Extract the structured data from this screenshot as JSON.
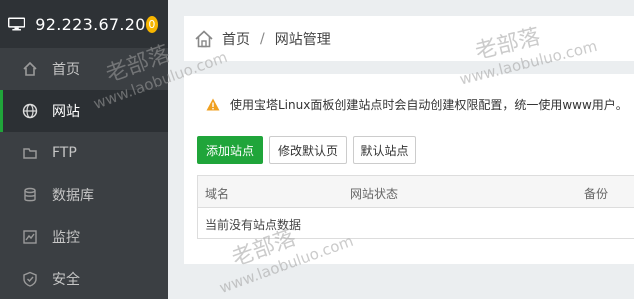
{
  "sidebar": {
    "ip": "92.223.67.20",
    "badge": "0",
    "items": [
      {
        "label": "首页"
      },
      {
        "label": "网站"
      },
      {
        "label": "FTP"
      },
      {
        "label": "数据库"
      },
      {
        "label": "监控"
      },
      {
        "label": "安全"
      }
    ]
  },
  "breadcrumb": {
    "home": "首页",
    "separator": "/",
    "current": "网站管理"
  },
  "notice": "使用宝塔Linux面板创建站点时会自动创建权限配置，统一使用www用户。",
  "buttons": {
    "add_site": "添加站点",
    "edit_default_page": "修改默认页",
    "default_site": "默认站点"
  },
  "table": {
    "columns": [
      "域名",
      "网站状态",
      "备份"
    ],
    "empty_text": "当前没有站点数据"
  },
  "watermark": {
    "text": "老部落",
    "url": "www.laobuluo.com"
  },
  "colors": {
    "accent": "#20a53a",
    "sidebar_bg": "#3b3f43",
    "badge": "#f7b500",
    "warning": "#f0a020"
  }
}
